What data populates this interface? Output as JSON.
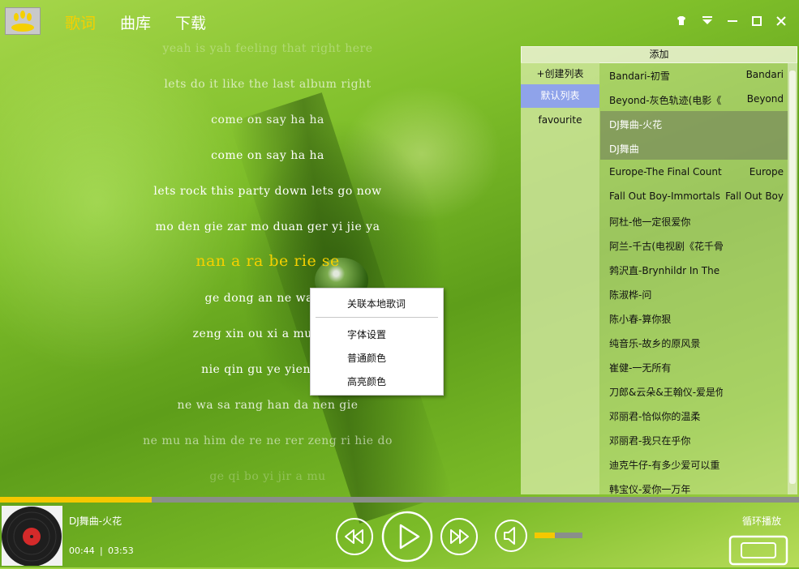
{
  "nav": {
    "lyrics": "歌词",
    "library": "曲库",
    "download": "下载"
  },
  "lyrics": [
    {
      "text": "yeah is yah feeling that right here",
      "opacity": 0.3
    },
    {
      "text": "lets do it like the last album right",
      "opacity": 0.65
    },
    {
      "text": "come on say ha ha",
      "opacity": 0.9
    },
    {
      "text": "come on say ha ha",
      "opacity": 1
    },
    {
      "text": "lets rock this party down lets go now",
      "opacity": 1
    },
    {
      "text": "mo den gie zar mo duan ger yi jie ya",
      "opacity": 1
    },
    {
      "text": "nan a ra be rie se",
      "current": true,
      "opacity": 1
    },
    {
      "text": "ge dong an ne wa sa",
      "opacity": 1
    },
    {
      "text": "zeng xin ou xi a mu ge d",
      "opacity": 1
    },
    {
      "text": "nie qin gu ye yien nin",
      "opacity": 1
    },
    {
      "text": "ne wa sa rang han da nen gie",
      "opacity": 0.8
    },
    {
      "text": "ne mu na him de re ne rer zeng ri hie do",
      "opacity": 0.55
    },
    {
      "text": "ge qi bo yi jir a mu",
      "opacity": 0.25
    }
  ],
  "context_menu": {
    "link_local": "关联本地歌词",
    "font_settings": "字体设置",
    "normal_color": "普通颜色",
    "highlight_color": "高亮颜色"
  },
  "panel": {
    "add": "添加",
    "playlists": [
      {
        "label": "+创建列表",
        "selected": false
      },
      {
        "label": "默认列表",
        "selected": true
      },
      {
        "label": "favourite",
        "selected": false
      }
    ],
    "songs": [
      {
        "title": "Bandari-初雪",
        "artist": "Bandari"
      },
      {
        "title": "Beyond-灰色轨迹(电影《",
        "artist": "Beyond"
      },
      {
        "title": "DJ舞曲-火花",
        "artist": "",
        "highlight": true
      },
      {
        "title": "DJ舞曲",
        "artist": "",
        "highlight": true
      },
      {
        "title": "Europe-The Final Count",
        "artist": "Europe"
      },
      {
        "title": "Fall Out Boy-Immortals",
        "artist": "Fall Out Boy"
      },
      {
        "title": "阿杜-他一定很爱你",
        "artist": ""
      },
      {
        "title": "阿兰-千古(电视剧《花千骨",
        "artist": ""
      },
      {
        "title": "鹁沢直-Brynhildr In The",
        "artist": ""
      },
      {
        "title": "陈淑桦-问",
        "artist": ""
      },
      {
        "title": "陈小春-算你狠",
        "artist": ""
      },
      {
        "title": "纯音乐-故乡的原风景",
        "artist": ""
      },
      {
        "title": "崔健-一无所有",
        "artist": ""
      },
      {
        "title": "刀郎&云朵&王翰仪-爱是你",
        "artist": ""
      },
      {
        "title": "邓丽君-恰似你的温柔",
        "artist": ""
      },
      {
        "title": "邓丽君-我只在乎你",
        "artist": ""
      },
      {
        "title": "迪克牛仔-有多少爱可以重",
        "artist": ""
      },
      {
        "title": "韩宝仪-爱你一万年",
        "artist": ""
      }
    ]
  },
  "player": {
    "song_name": "DJ舞曲-火花",
    "current_time": "00:44",
    "divider": "|",
    "total_time": "03:53",
    "progress": 0.19,
    "volume": 0.42,
    "mode": "循环播放"
  },
  "colors": {
    "accent": "#f5d000",
    "playlist_selected": "#8fa3ea"
  }
}
